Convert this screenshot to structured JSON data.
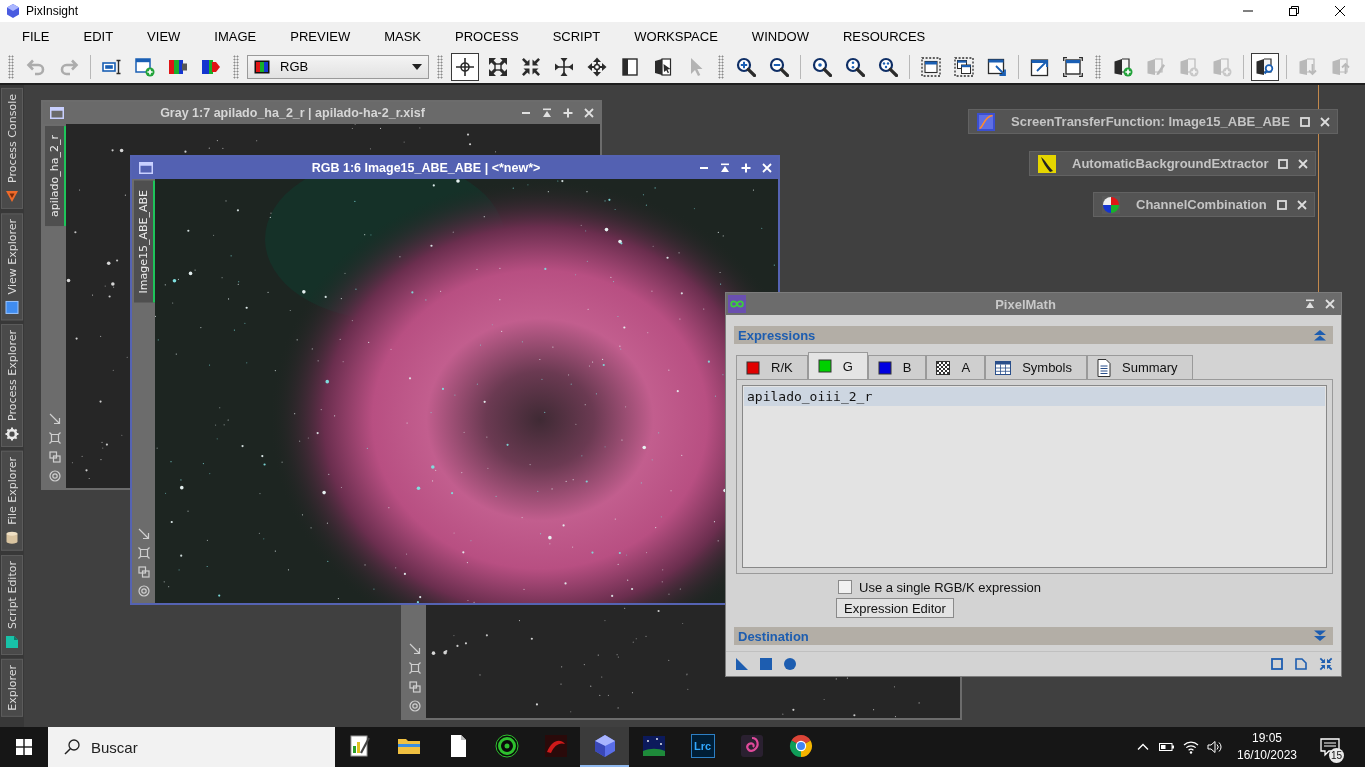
{
  "app": {
    "title": "PixInsight"
  },
  "menu": [
    "FILE",
    "EDIT",
    "VIEW",
    "IMAGE",
    "PREVIEW",
    "MASK",
    "PROCESS",
    "SCRIPT",
    "WORKSPACE",
    "WINDOW",
    "RESOURCES"
  ],
  "toolbar": {
    "groups": [
      {
        "kind": "grip",
        "items": [
          {
            "kind": "undo",
            "pressed": false,
            "disabled": true
          },
          {
            "kind": "redo",
            "pressed": false,
            "disabled": true
          }
        ]
      },
      {
        "kind": "line",
        "items": [
          {
            "kind": "identifier",
            "pressed": false,
            "disabled": false
          },
          {
            "kind": "new-image",
            "pressed": false,
            "disabled": false
          },
          {
            "kind": "split-channels",
            "pressed": false,
            "disabled": false
          },
          {
            "kind": "combine-channels",
            "pressed": false,
            "disabled": false
          }
        ]
      },
      {
        "kind": "grip",
        "dropdown": {
          "value": "RGB"
        }
      },
      {
        "kind": "grip",
        "items": [
          {
            "kind": "crosshair",
            "pressed": true,
            "disabled": false
          },
          {
            "kind": "arrows-out",
            "pressed": false,
            "disabled": false
          },
          {
            "kind": "arrows-in",
            "pressed": false,
            "disabled": false
          },
          {
            "kind": "arrows-center",
            "pressed": false,
            "disabled": false
          },
          {
            "kind": "pan",
            "pressed": false,
            "disabled": false
          },
          {
            "kind": "page",
            "pressed": false,
            "disabled": false
          },
          {
            "kind": "page-cursor",
            "pressed": false,
            "disabled": false
          },
          {
            "kind": "pointer",
            "pressed": false,
            "disabled": true
          }
        ]
      },
      {
        "kind": "grip",
        "items": [
          {
            "kind": "zoom-in",
            "pressed": false,
            "disabled": false
          },
          {
            "kind": "zoom-out",
            "pressed": false,
            "disabled": false
          }
        ]
      },
      {
        "kind": "line",
        "items": [
          {
            "kind": "zoom-dot",
            "pressed": false,
            "disabled": false
          },
          {
            "kind": "zoom-one",
            "pressed": false,
            "disabled": false
          },
          {
            "kind": "zoom-dots",
            "pressed": false,
            "disabled": false
          }
        ]
      },
      {
        "kind": "line",
        "items": [
          {
            "kind": "window-dashed",
            "pressed": false,
            "disabled": false
          },
          {
            "kind": "windows-dashed",
            "pressed": false,
            "disabled": false
          },
          {
            "kind": "window-arrow",
            "pressed": false,
            "disabled": false
          }
        ]
      },
      {
        "kind": "line",
        "items": [
          {
            "kind": "window-arrow-up",
            "pressed": false,
            "disabled": false
          },
          {
            "kind": "window-frame",
            "pressed": false,
            "disabled": false
          }
        ]
      },
      {
        "kind": "grip",
        "items": [
          {
            "kind": "document-add",
            "pressed": false,
            "disabled": false
          },
          {
            "kind": "document-edit",
            "pressed": false,
            "disabled": true
          },
          {
            "kind": "document-plus",
            "pressed": false,
            "disabled": true
          },
          {
            "kind": "document-plus",
            "pressed": false,
            "disabled": true
          }
        ]
      },
      {
        "kind": "line",
        "items": [
          {
            "kind": "document-search",
            "pressed": true,
            "disabled": false
          }
        ]
      },
      {
        "kind": "line",
        "items": [
          {
            "kind": "document-down",
            "pressed": false,
            "disabled": true
          },
          {
            "kind": "document-up",
            "pressed": false,
            "disabled": true
          }
        ]
      }
    ]
  },
  "dock_tabs": [
    {
      "label": "Process Console",
      "kind": "console"
    },
    {
      "label": "View Explorer",
      "kind": "view"
    },
    {
      "label": "Process Explorer",
      "kind": "process"
    },
    {
      "label": "File Explorer",
      "kind": "file"
    },
    {
      "label": "Script Editor",
      "kind": "script"
    },
    {
      "label": "Explorer",
      "kind": "plain"
    }
  ],
  "image_windows": [
    {
      "title": "Gray 1:7 apilado_ha_2_r | apilado-ha-2_r.xisf",
      "view_tab": "apilado_ha_2_r",
      "kind": "grayscale",
      "active": false
    },
    {
      "title": "RGB 1:6 Image15_ABE_ABE | <*new*>",
      "view_tab": "Image15_ABE_ABE",
      "kind": "color",
      "active": true
    },
    {
      "kind": "grayscale",
      "active": false
    }
  ],
  "process_icons": [
    {
      "kind": "stf",
      "label": "ScreenTransferFunction: Image15_ABE_ABE"
    },
    {
      "kind": "abe",
      "label": "AutomaticBackgroundExtractor"
    },
    {
      "kind": "channel-combination",
      "label": "ChannelCombination"
    }
  ],
  "pixelmath": {
    "title": "PixelMath",
    "expressions": {
      "title": "Expressions",
      "expanded": true,
      "tabs": [
        {
          "label": "R/K",
          "kind": "swatch",
          "color": "#e00000",
          "selected": false
        },
        {
          "label": "G",
          "kind": "swatch",
          "color": "#00d000",
          "selected": true
        },
        {
          "label": "B",
          "kind": "swatch",
          "color": "#0000e0",
          "selected": false
        },
        {
          "label": "A",
          "kind": "alpha",
          "selected": false
        },
        {
          "label": "Symbols",
          "kind": "table",
          "selected": false
        },
        {
          "label": "Summary",
          "kind": "document",
          "selected": false
        }
      ],
      "lines": [
        "apilado_oiii_2_r"
      ],
      "single_expression": {
        "label": "Use a single RGB/K expression",
        "checked": false
      },
      "editor_button": "Expression Editor"
    },
    "destination": {
      "title": "Destination",
      "expanded": false
    }
  },
  "taskbar": {
    "search": {
      "placeholder": "Buscar"
    },
    "apps": [
      {
        "kind": "chart-note",
        "active": false
      },
      {
        "kind": "folder",
        "active": false
      },
      {
        "kind": "blank-page",
        "active": false
      },
      {
        "kind": "ring",
        "active": false
      },
      {
        "kind": "swoosh",
        "active": false
      },
      {
        "kind": "cube",
        "active": true
      },
      {
        "kind": "night-sky",
        "active": false
      },
      {
        "kind": "lettered-tile",
        "label": "Lrc",
        "active": false
      },
      {
        "kind": "swirl",
        "active": false
      },
      {
        "kind": "segmented-circle",
        "active": false
      }
    ],
    "clock": {
      "time": "19:05",
      "date": "16/10/2023"
    },
    "notifications": {
      "count": "15"
    }
  }
}
